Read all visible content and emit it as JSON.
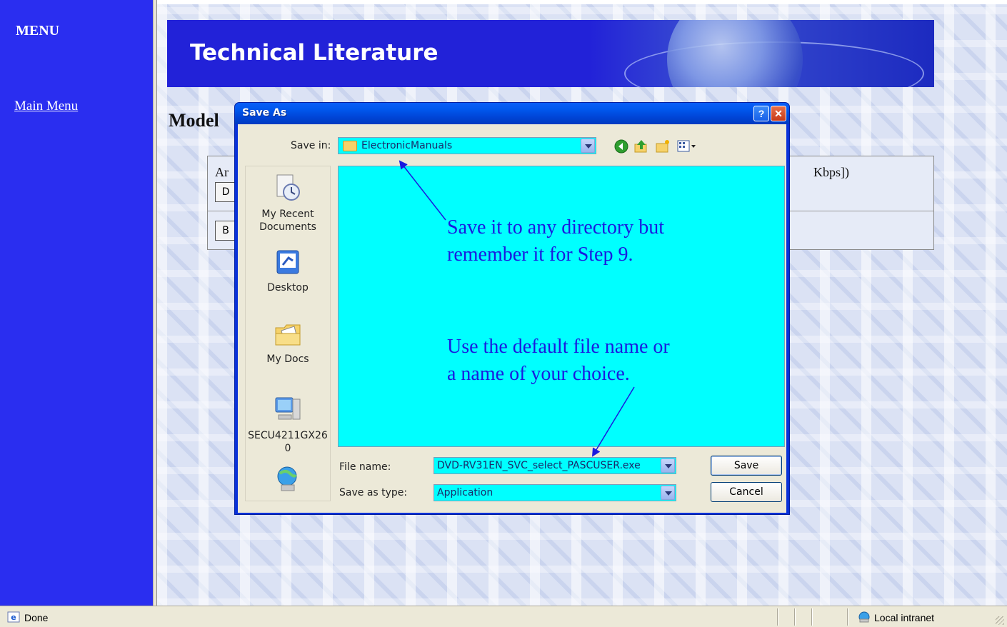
{
  "menu": {
    "title": "MENU",
    "main_menu_link": "Main Menu"
  },
  "content": {
    "banner_title": "Technical Literature",
    "heading_partial": "Model",
    "table": {
      "row1_left_partial": "Ar",
      "row1_right_partial": "Kbps])",
      "row1_button_partial": "D",
      "row2_button_partial": "B"
    }
  },
  "dialog": {
    "title": "Save As",
    "help_glyph": "?",
    "close_glyph": "✕",
    "save_in_label": "Save in:",
    "save_in_value": "ElectronicManuals",
    "places": [
      {
        "label": "My Recent\nDocuments",
        "icon": "recent-documents-icon"
      },
      {
        "label": "Desktop",
        "icon": "desktop-icon"
      },
      {
        "label": "My Docs",
        "icon": "my-documents-icon"
      },
      {
        "label": "SECU4211GX26\n0",
        "icon": "my-computer-icon"
      },
      {
        "label": "",
        "icon": "network-places-icon"
      }
    ],
    "file_name_label": "File name:",
    "file_name_value": "DVD-RV31EN_SVC_select_PASCUSER.exe",
    "save_as_type_label": "Save as type:",
    "save_as_type_value": "Application",
    "save_button": "Save",
    "cancel_button": "Cancel"
  },
  "annotations": {
    "note1_line1": "Save it to any directory but",
    "note1_line2": "remember it for Step 9.",
    "note2_line1": "Use the default file name or",
    "note2_line2": "a name of your choice."
  },
  "status_bar": {
    "status_text": "Done",
    "zone_text": "Local intranet"
  },
  "colors": {
    "menu_bg": "#2a2ef0",
    "banner_bg": "#2222d8",
    "highlight_cyan": "#00ffff",
    "annotation_text": "#1a1adf",
    "dialog_title_bar": "#0058ee"
  }
}
